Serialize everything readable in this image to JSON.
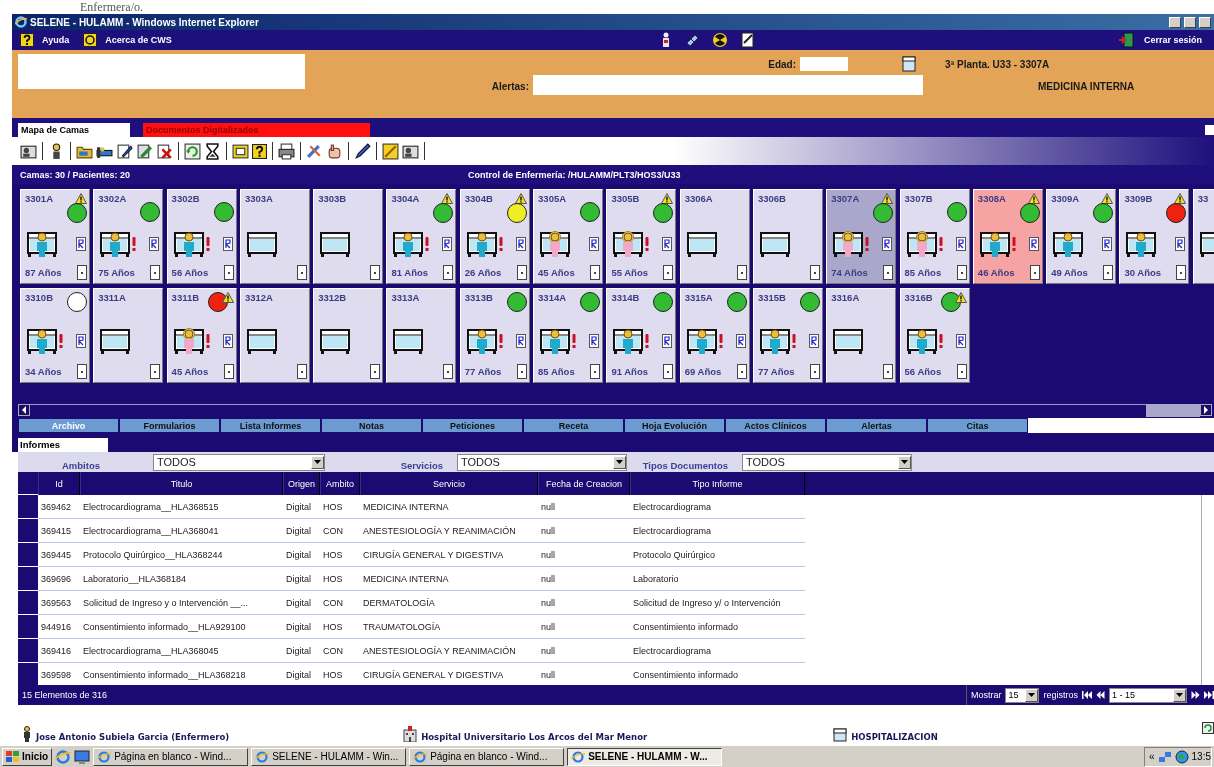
{
  "page_above": {
    "text": "Enfermera/o."
  },
  "window": {
    "title": "SELENE - HULAMM - Windows Internet Explorer"
  },
  "menu": [
    {
      "label": "Ayuda",
      "kind": "help"
    },
    {
      "label": "Acerca de CWS",
      "kind": "about"
    }
  ],
  "logout": {
    "label": "Cerrar sesión"
  },
  "patient": {
    "age_label": "Edad:",
    "alerts_label": "Alertas:",
    "location": "3ª Planta. U33 - 3307A",
    "service": "MEDICINA INTERNA"
  },
  "view_tabs": [
    {
      "label": "Mapa de Camas",
      "selected": true
    },
    {
      "label": "Documentos Digitalizados",
      "selected": false
    }
  ],
  "view_toggle": {
    "checked": false
  },
  "summary": {
    "counts": "Camas: 30 / Pacientes: 20",
    "unit": "Control de Enfermería: /HULAMM/PLT3/HOS3/U33"
  },
  "bed_rows": [
    [
      {
        "id": "3301A",
        "kind": "male",
        "color": "#33bb33",
        "warning": true,
        "alert": false,
        "selected": false,
        "flagged": false,
        "age": "87 Años"
      },
      {
        "id": "3302A",
        "kind": "male",
        "color": "#33bb33",
        "warning": false,
        "alert": true,
        "selected": false,
        "flagged": false,
        "age": "75 Años"
      },
      {
        "id": "3302B",
        "kind": "male",
        "color": "#33bb33",
        "warning": false,
        "alert": true,
        "selected": false,
        "flagged": false,
        "age": "56 Años"
      },
      {
        "id": "3303A",
        "kind": "empty",
        "warning": false,
        "alert": false,
        "selected": false,
        "flagged": false
      },
      {
        "id": "3303B",
        "kind": "empty",
        "warning": false,
        "alert": false,
        "selected": false,
        "flagged": false
      },
      {
        "id": "3304A",
        "kind": "male",
        "color": "#33bb33",
        "warning": true,
        "alert": true,
        "selected": false,
        "flagged": false,
        "age": "81 Años"
      },
      {
        "id": "3304B",
        "kind": "male",
        "color": "#eeee22",
        "warning": true,
        "alert": true,
        "selected": false,
        "flagged": false,
        "age": "26 Años"
      },
      {
        "id": "3305A",
        "kind": "female",
        "color": "#33bb33",
        "warning": false,
        "alert": false,
        "selected": false,
        "flagged": false,
        "age": "45 Años"
      },
      {
        "id": "3305B",
        "kind": "female",
        "color": "#33bb33",
        "warning": true,
        "alert": true,
        "selected": false,
        "flagged": false,
        "age": "55 Años"
      },
      {
        "id": "3306A",
        "kind": "empty",
        "warning": false,
        "alert": false,
        "selected": false,
        "flagged": false
      },
      {
        "id": "3306B",
        "kind": "empty",
        "warning": false,
        "alert": false,
        "selected": false,
        "flagged": false
      },
      {
        "id": "3307A",
        "kind": "female",
        "color": "#33bb33",
        "warning": true,
        "alert": true,
        "selected": true,
        "flagged": false,
        "age": "74 Años"
      },
      {
        "id": "3307B",
        "kind": "female",
        "color": "#33bb33",
        "warning": false,
        "alert": true,
        "selected": false,
        "flagged": false,
        "age": "85 Años"
      },
      {
        "id": "3308A",
        "kind": "male",
        "color": "#33bb33",
        "warning": true,
        "alert": true,
        "selected": false,
        "flagged": true,
        "age": "46 Años"
      },
      {
        "id": "3309A",
        "kind": "male",
        "color": "#33bb33",
        "warning": true,
        "alert": false,
        "selected": false,
        "flagged": false,
        "age": "49 Años"
      },
      {
        "id": "3309B",
        "kind": "male",
        "color": "#ee2211",
        "warning": true,
        "alert": false,
        "selected": false,
        "flagged": false,
        "age": "30 Años"
      },
      {
        "id": "33",
        "kind": "empty",
        "warning": false,
        "alert": false,
        "selected": false,
        "flagged": false
      }
    ],
    [
      {
        "id": "3310B",
        "kind": "male",
        "color": "#ffffff",
        "warning": false,
        "alert": true,
        "selected": false,
        "flagged": false,
        "age": "34 Años"
      },
      {
        "id": "3311A",
        "kind": "empty",
        "warning": false,
        "alert": false,
        "selected": false,
        "flagged": false
      },
      {
        "id": "3311B",
        "kind": "female",
        "color": "#ee2211",
        "warning": true,
        "alert": true,
        "selected": false,
        "flagged": false,
        "age": "45 Años"
      },
      {
        "id": "3312A",
        "kind": "empty",
        "warning": false,
        "alert": false,
        "selected": false,
        "flagged": false
      },
      {
        "id": "3312B",
        "kind": "empty",
        "warning": false,
        "alert": false,
        "selected": false,
        "flagged": false
      },
      {
        "id": "3313A",
        "kind": "empty",
        "warning": false,
        "alert": false,
        "selected": false,
        "flagged": false
      },
      {
        "id": "3313B",
        "kind": "male",
        "color": "#33bb33",
        "warning": false,
        "alert": true,
        "selected": false,
        "flagged": false,
        "age": "77 Años"
      },
      {
        "id": "3314A",
        "kind": "male",
        "color": "#33bb33",
        "warning": false,
        "alert": true,
        "selected": false,
        "flagged": false,
        "age": "85 Años"
      },
      {
        "id": "3314B",
        "kind": "male",
        "color": "#33bb33",
        "warning": false,
        "alert": true,
        "selected": false,
        "flagged": false,
        "age": "91 Años"
      },
      {
        "id": "3315A",
        "kind": "male",
        "color": "#33bb33",
        "warning": false,
        "alert": true,
        "selected": false,
        "flagged": false,
        "age": "69 Años"
      },
      {
        "id": "3315B",
        "kind": "male",
        "color": "#33bb33",
        "warning": false,
        "alert": true,
        "selected": false,
        "flagged": false,
        "age": "77 Años"
      },
      {
        "id": "3316A",
        "kind": "empty",
        "warning": false,
        "alert": false,
        "selected": false,
        "flagged": false
      },
      {
        "id": "3316B",
        "kind": "male",
        "color": "#33bb33",
        "warning": true,
        "alert": true,
        "selected": false,
        "flagged": false,
        "age": "56 Años"
      }
    ]
  ],
  "tabs": [
    {
      "label": "Archivo",
      "selected": true
    },
    {
      "label": "Formularios",
      "selected": false
    },
    {
      "label": "Lista Informes",
      "selected": false
    },
    {
      "label": "Notas",
      "selected": false
    },
    {
      "label": "Peticiones",
      "selected": false
    },
    {
      "label": "Receta",
      "selected": false
    },
    {
      "label": "Hoja Evolución",
      "selected": false
    },
    {
      "label": "Actos Clínicos",
      "selected": false
    },
    {
      "label": "Alertas",
      "selected": false
    },
    {
      "label": "Citas",
      "selected": false
    }
  ],
  "section_tab": {
    "label": "Informes"
  },
  "filters": [
    {
      "label": "Ambitos",
      "value": "TODOS"
    },
    {
      "label": "Servicios",
      "value": "TODOS"
    },
    {
      "label": "Tipos Documentos",
      "value": "TODOS"
    }
  ],
  "table": {
    "columns": [
      "Id",
      "Titulo",
      "Origen",
      "Ambito",
      "Servicio",
      "Fecha de Creacion",
      "Tipo Informe"
    ],
    "rows": [
      [
        "369462",
        "Electrocardiograma__HLA368515",
        "Digital",
        "HOS",
        "MEDICINA INTERNA",
        "null",
        "Electrocardiograma"
      ],
      [
        "369415",
        "Electrocardiograma__HLA368041",
        "Digital",
        "CON",
        "ANESTESIOLOGÍA Y REANIMACIÓN",
        "null",
        "Electrocardiograma"
      ],
      [
        "369445",
        "Protocolo Quirúrgico__HLA368244",
        "Digital",
        "HOS",
        "CIRUGÍA GENERAL Y DIGESTIVA",
        "null",
        "Protocolo Quirúrgico"
      ],
      [
        "369696",
        "Laboratorio__HLA368184",
        "Digital",
        "HOS",
        "MEDICINA INTERNA",
        "null",
        "Laboratorio"
      ],
      [
        "369563",
        "Solicitud de Ingreso y o Intervención __...",
        "Digital",
        "CON",
        "DERMATOLOGÍA",
        "null",
        "Solicitud de Ingreso y/ o Intervención"
      ],
      [
        "944916",
        "Consentimiento informado__HLA929100",
        "Digital",
        "HOS",
        "TRAUMATOLOGÍA",
        "null",
        "Consentimiento informado"
      ],
      [
        "369416",
        "Electrocardiograma__HLA368045",
        "Digital",
        "CON",
        "ANESTESIOLOGÍA Y REANIMACIÓN",
        "null",
        "Electrocardiograma"
      ],
      [
        "369598",
        "Consentimiento informado__HLA368218",
        "Digital",
        "HOS",
        "CIRUGÍA GENERAL Y DIGESTIVA",
        "null",
        "Consentimiento informado"
      ]
    ]
  },
  "footer": {
    "count": "15 Elementos de 316",
    "show_label": "Mostrar",
    "page_size": "15",
    "records_label": "registros",
    "range": "1 - 15"
  },
  "status_bar": {
    "user": "Jose Antonio Subiela Garcia (Enfermero)",
    "hospital": "Hospital Universitario Los Arcos del Mar Menor",
    "area": "HOSPITALIZACION"
  },
  "taskbar": {
    "start": "Inicio",
    "tasks": [
      {
        "label": "Página en blanco - Wind...",
        "selected": false
      },
      {
        "label": "SELENE - HULAMM - Win...",
        "selected": false
      },
      {
        "label": "Página en blanco - Wind...",
        "selected": false
      },
      {
        "label": "SELENE - HULAMM - W...",
        "selected": true
      }
    ],
    "tray": "«",
    "clock": "13:5"
  }
}
